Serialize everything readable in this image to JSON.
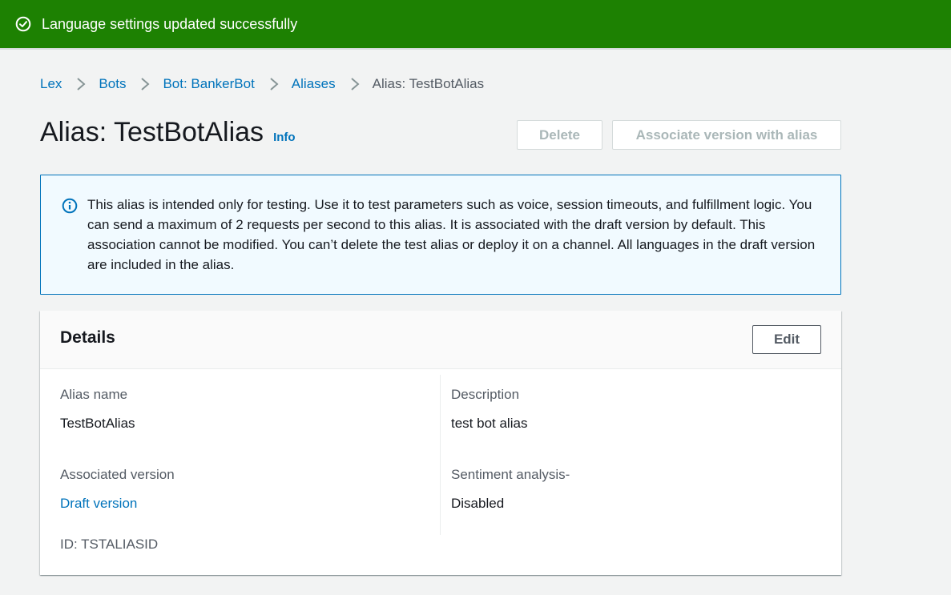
{
  "flash": {
    "message": "Language settings updated successfully",
    "color": "#1d8102"
  },
  "breadcrumb": {
    "items": [
      {
        "label": "Lex"
      },
      {
        "label": "Bots"
      },
      {
        "label": "Bot: BankerBot"
      },
      {
        "label": "Aliases"
      }
    ],
    "current": "Alias: TestBotAlias"
  },
  "header": {
    "title": "Alias: TestBotAlias",
    "info_label": "Info",
    "delete_label": "Delete",
    "associate_label": "Associate version with alias"
  },
  "alert": {
    "icon": "info-icon",
    "text": "This alias is intended only for testing. Use it to test parameters such as voice, session timeouts, and fulfillment logic. You can send a maximum of 2 requests per second to this alias. It is associated with the draft version by default. This association cannot be modified. You can’t delete the test alias or deploy it on a channel. All languages in the draft version are included in the alias."
  },
  "details": {
    "title": "Details",
    "edit_label": "Edit",
    "alias_name_label": "Alias name",
    "alias_name_value": "TestBotAlias",
    "associated_version_label": "Associated version",
    "associated_version_value": "Draft version",
    "id_text": "ID: TSTALIASID",
    "description_label": "Description",
    "description_value": "test bot alias",
    "sentiment_label": "Sentiment analysis-",
    "sentiment_value": "Disabled"
  }
}
